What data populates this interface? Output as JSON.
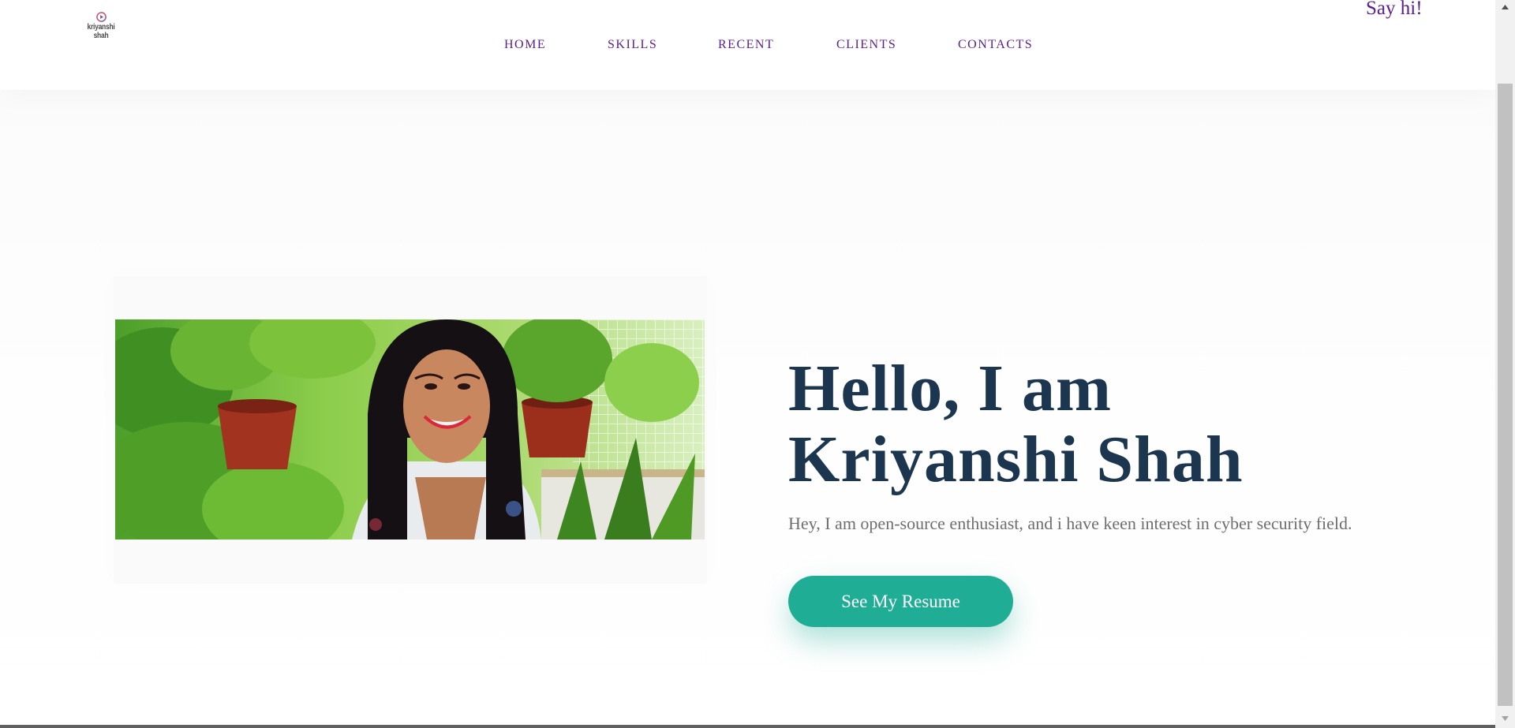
{
  "header": {
    "logo_text": "kriyanshi shah",
    "nav": [
      {
        "label": "HOME"
      },
      {
        "label": "SKILLS"
      },
      {
        "label": "RECENT"
      },
      {
        "label": "CLIENTS"
      },
      {
        "label": "CONTACTS"
      }
    ],
    "say_hi": "Say hi!"
  },
  "hero": {
    "title_line1": "Hello, I am",
    "title_line2": "Kriyanshi Shah",
    "description": "Hey, I am open-source enthusiast, and i have keen interest in cyber security field.",
    "resume_button": "See My Resume"
  },
  "colors": {
    "nav_text": "#5b1f8c",
    "title": "#1c3650",
    "button": "#20ad96",
    "description": "#6e6e6e"
  },
  "icons": {
    "logo": "play-circle-logo-icon",
    "scroll_up": "triangle-up-icon",
    "scroll_down": "triangle-down-icon"
  }
}
